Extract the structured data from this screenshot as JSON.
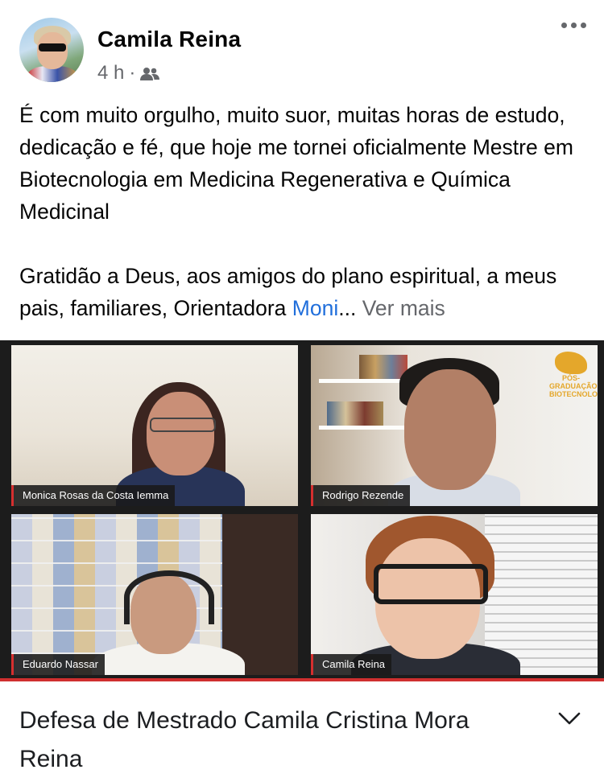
{
  "post": {
    "author": "Camila Reina",
    "time": "4 h",
    "separator": "·",
    "audience_icon": "friends-icon",
    "more_icon": "more-options-icon",
    "text_p1": "É com muito orgulho, muito suor, muitas horas de estudo, dedicação e fé, que hoje me tornei oficialmente Mestre em  Biotecnologia em Medicina Regenerativa e Química Medicinal",
    "text_p2_before": "Gratidão a Deus, aos amigos do plano espiritual, a meus pais, familiares, Orientadora ",
    "mention": "Moni",
    "ellipsis": "...",
    "see_more": "Ver mais"
  },
  "video": {
    "participants": [
      {
        "name": "Monica Rosas da Costa Iemma"
      },
      {
        "name": "Rodrigo Rezende"
      },
      {
        "name": "Eduardo Nassar"
      },
      {
        "name": "Camila Reina"
      }
    ],
    "logo_text": "PÓS-GRADUAÇÃO BIOTECNOLOGIA"
  },
  "caption": {
    "title": "Defesa de Mestrado Camila Cristina Mora Reina",
    "expand_icon": "chevron-down-icon"
  },
  "colors": {
    "link": "#216fdb",
    "secondary_text": "#65676b",
    "video_accent": "#d62f2f"
  }
}
